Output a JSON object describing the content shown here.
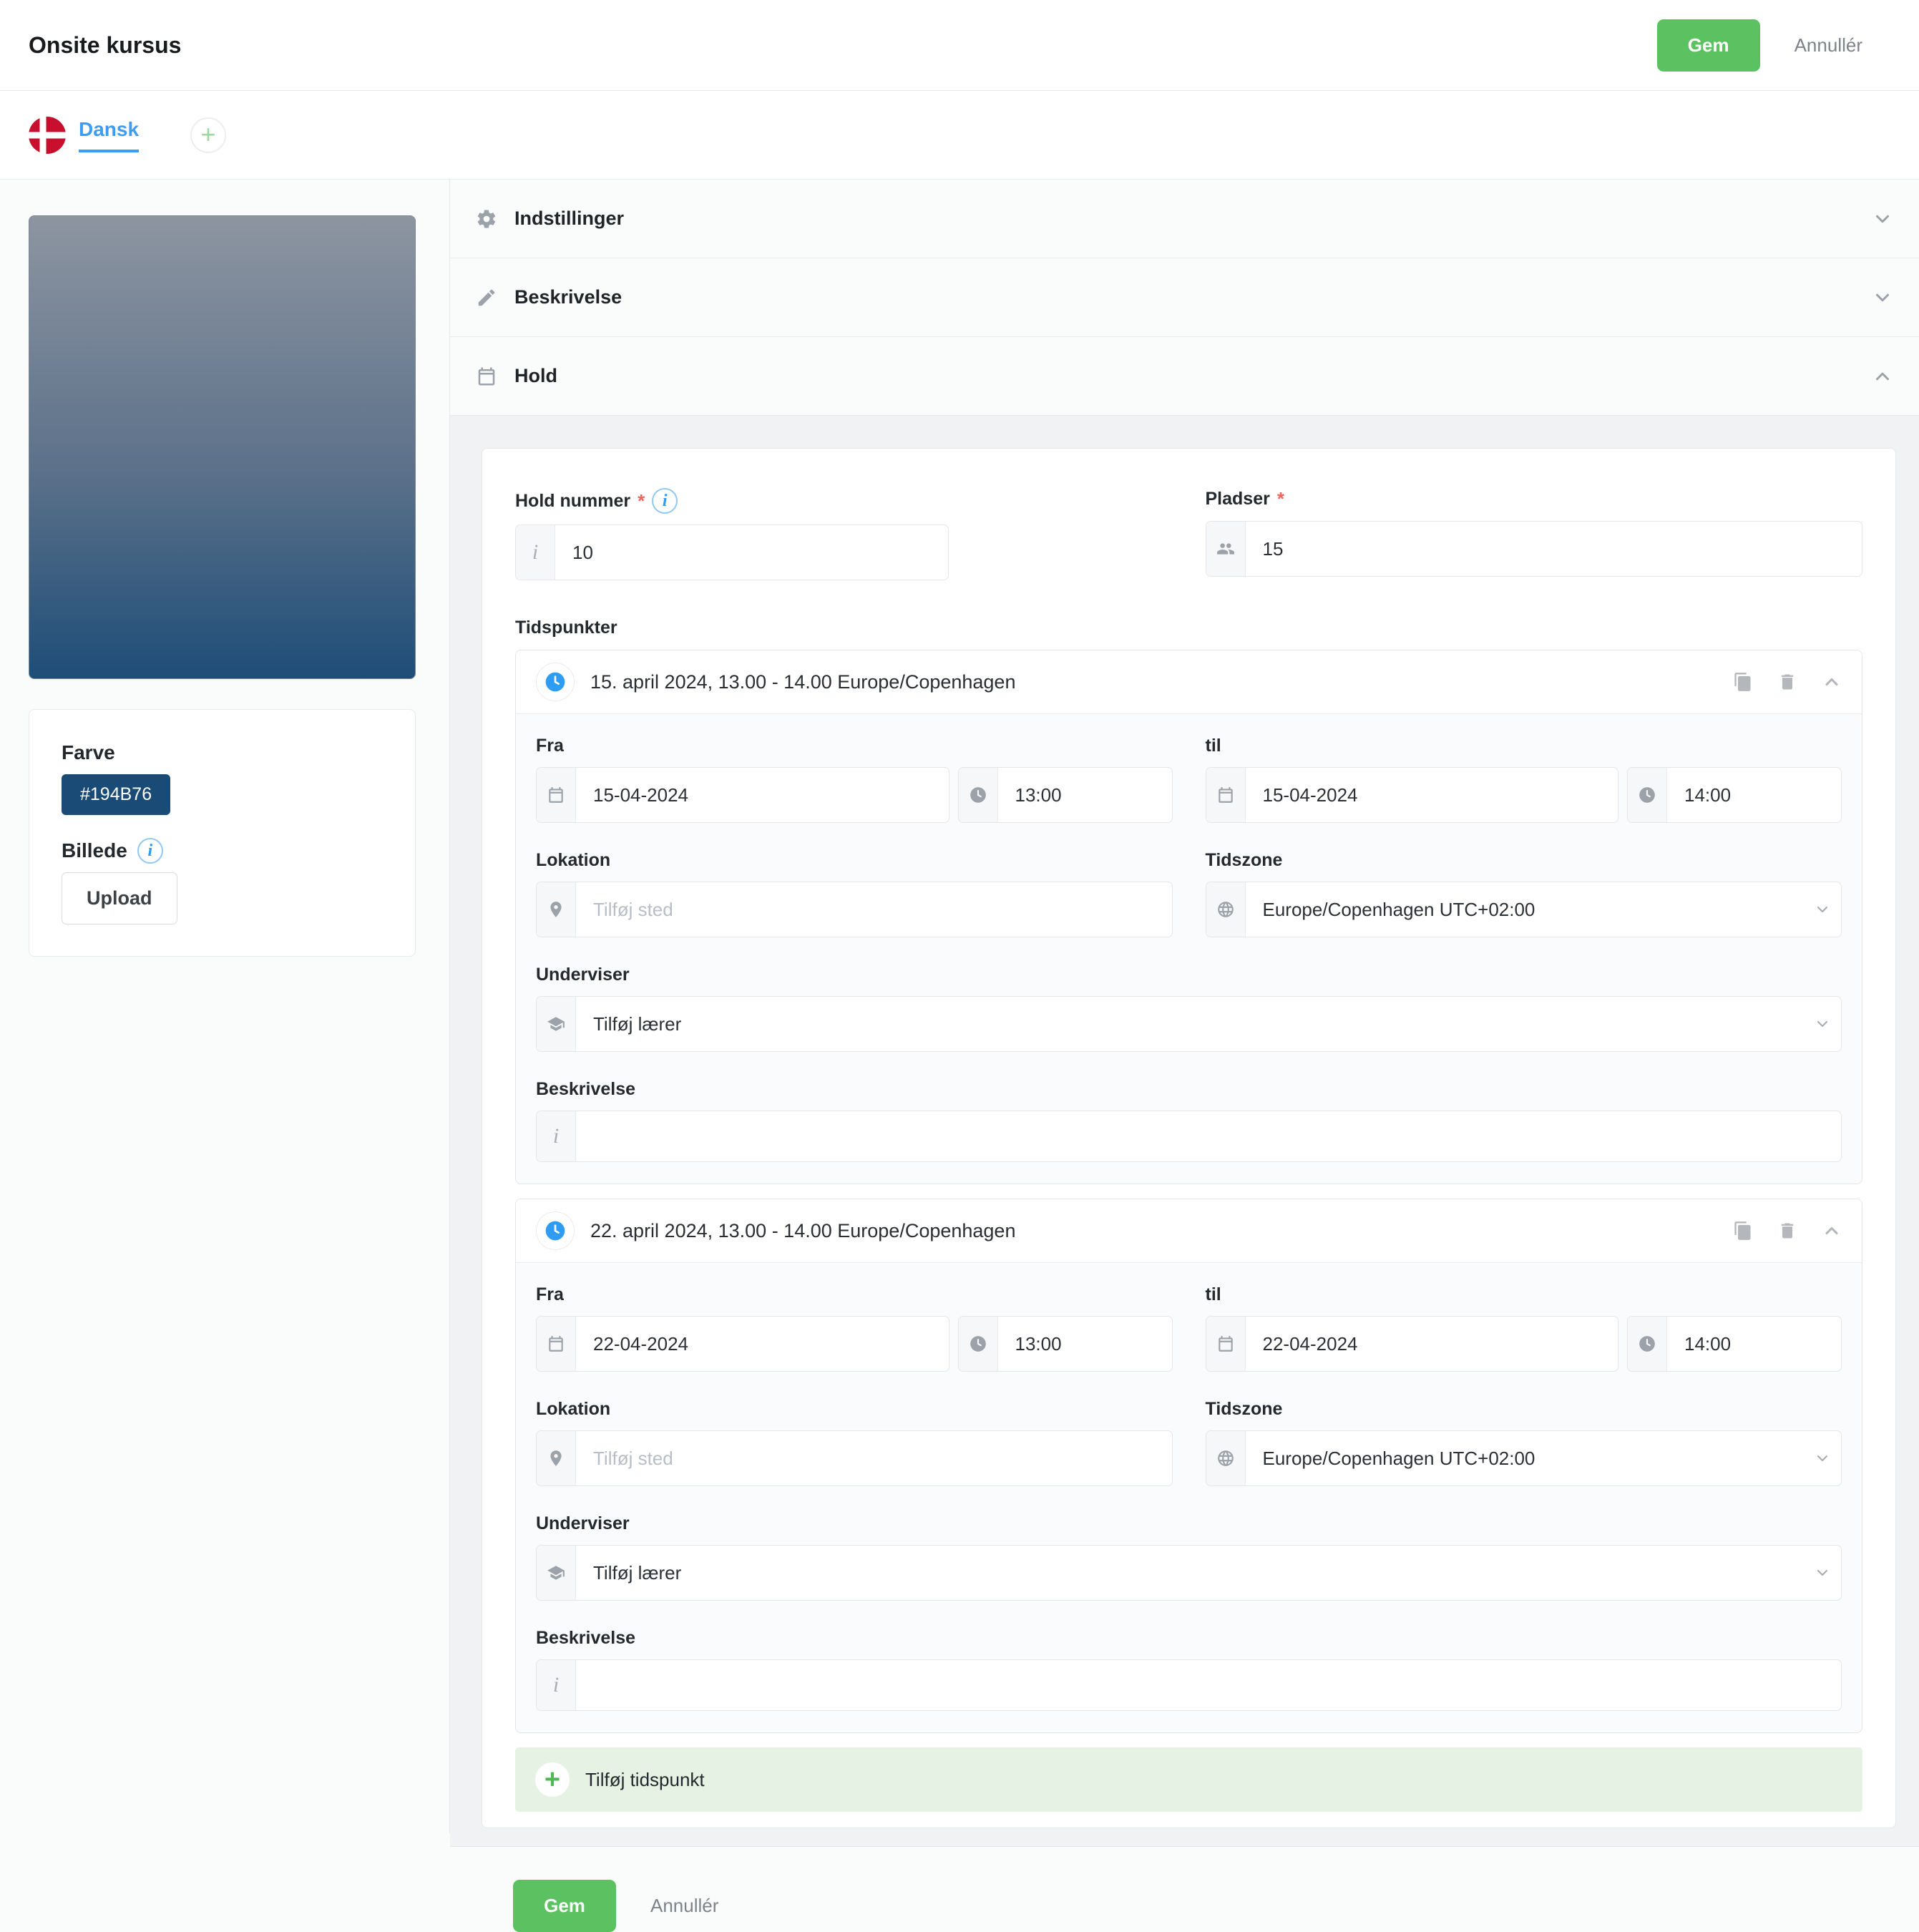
{
  "header": {
    "title": "Onsite kursus",
    "save_label": "Gem",
    "cancel_label": "Annullér"
  },
  "language_bar": {
    "active_language": "Dansk",
    "add_label": "+"
  },
  "sidebar": {
    "color_label": "Farve",
    "color_value": "#194B76",
    "image_label": "Billede",
    "upload_label": "Upload"
  },
  "accordion": [
    {
      "label": "Indstillinger",
      "icon": "gear-icon",
      "state": "collapsed"
    },
    {
      "label": "Beskrivelse",
      "icon": "pencil-icon",
      "state": "collapsed"
    },
    {
      "label": "Hold",
      "icon": "calendar-icon",
      "state": "expanded"
    }
  ],
  "hold": {
    "hold_nummer_label": "Hold nummer",
    "hold_nummer_value": "10",
    "pladser_label": "Pladser",
    "pladser_value": "15",
    "required_marker": "*",
    "tidspunkter_label": "Tidspunkter",
    "labels": {
      "fra": "Fra",
      "til": "til",
      "lokation": "Lokation",
      "tidszone": "Tidszone",
      "underviser": "Underviser",
      "beskrivelse": "Beskrivelse"
    },
    "timeslots": [
      {
        "title": "15. april 2024, 13.00 - 14.00 Europe/Copenhagen",
        "from_date": "15-04-2024",
        "from_time": "13:00",
        "to_date": "15-04-2024",
        "to_time": "14:00",
        "location_placeholder": "Tilføj sted",
        "timezone_value": "Europe/Copenhagen UTC+02:00",
        "teacher_label": "Tilføj lærer",
        "description_value": ""
      },
      {
        "title": "22. april 2024, 13.00 - 14.00 Europe/Copenhagen",
        "from_date": "22-04-2024",
        "from_time": "13:00",
        "to_date": "22-04-2024",
        "to_time": "14:00",
        "location_placeholder": "Tilføj sted",
        "timezone_value": "Europe/Copenhagen UTC+02:00",
        "teacher_label": "Tilføj lærer",
        "description_value": ""
      }
    ],
    "add_timeslot_label": "Tilføj tidspunkt"
  },
  "footer": {
    "save_label": "Gem",
    "cancel_label": "Annullér"
  },
  "icons": {
    "info_glyph": "i",
    "input_info_glyph": "i",
    "plus_glyph": "+"
  },
  "colors": {
    "accent_green": "#5cc160",
    "link_blue": "#3d9cf4",
    "required_red": "#f4625c",
    "chip_navy": "#194B76",
    "clock_blue": "#2f9cf3"
  }
}
